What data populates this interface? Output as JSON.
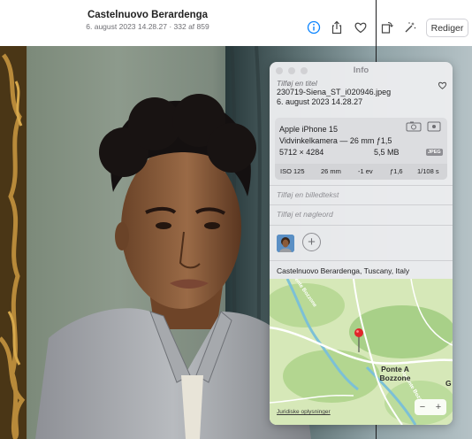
{
  "header": {
    "title": "Castelnuovo Berardenga",
    "subtitle": "6. august 2023 14.28.27 · 332 af 859",
    "edit_label": "Rediger"
  },
  "toolbar_icons": [
    "info-icon",
    "share-icon",
    "heart-icon",
    "rotate-icon",
    "enhance-icon"
  ],
  "info": {
    "panel_title": "Info",
    "add_title_placeholder": "Tilføj en titel",
    "filename": "230719-Siena_ST_i020946.jpeg",
    "date": "6. august 2023  14.28.27",
    "camera": {
      "model": "Apple iPhone 15",
      "lens": "Vidvinkelkamera — 26 mm ƒ1,5",
      "resolution": "5712 × 4284",
      "filesize": "5,5 MB",
      "format": "JPEG",
      "exif": {
        "iso": "ISO 125",
        "focal": "26 mm",
        "ev": "-1 ev",
        "aperture": "ƒ1,6",
        "shutter": "1/108 s"
      }
    },
    "caption_placeholder": "Tilføj en billedtekst",
    "keyword_placeholder": "Tilføj et nøgleord",
    "add_face_label": "+",
    "location": "Castelnuovo Berardenga, Tuscany, Italy"
  },
  "map": {
    "place_line1": "Ponte A",
    "place_line2": "Bozzone",
    "road_top": "Torrente Bozzone",
    "road_bottom": "Torrente Bozz",
    "edge_letter": "G",
    "legal": "Juridiske oplysninger",
    "zoom_out": "−",
    "zoom_in": "+"
  },
  "colors": {
    "accent": "#0a84ff",
    "pin": "#e0262b"
  }
}
